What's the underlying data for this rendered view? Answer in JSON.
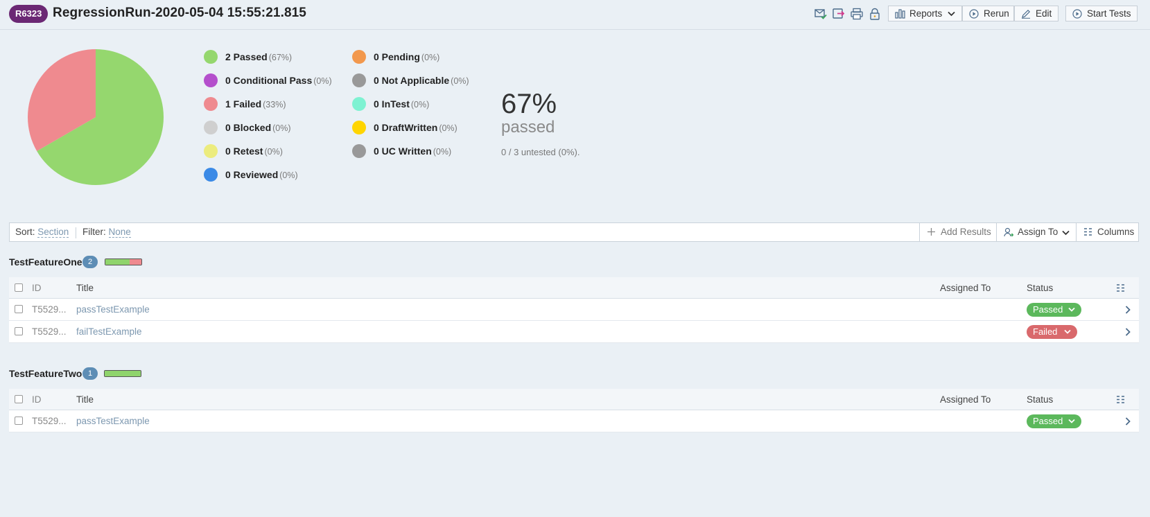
{
  "header": {
    "run_id": "R6323",
    "title": "RegressionRun-2020-05-04 15:55:21.815",
    "buttons": {
      "reports": "Reports",
      "rerun": "Rerun",
      "edit": "Edit",
      "start_tests": "Start Tests"
    }
  },
  "summary": {
    "chart_data": {
      "type": "pie",
      "categories": [
        "Passed",
        "Failed"
      ],
      "values": [
        2,
        1
      ],
      "colors": [
        "#95d76e",
        "#ef8a8f"
      ]
    },
    "legend": [
      {
        "label": "2 Passed",
        "pct": "(67%)",
        "color": "#95d76e"
      },
      {
        "label": "0 Conditional Pass",
        "pct": "(0%)",
        "color": "#b44fcc"
      },
      {
        "label": "1 Failed",
        "pct": "(33%)",
        "color": "#ef8a8f"
      },
      {
        "label": "0 Blocked",
        "pct": "(0%)",
        "color": "#cfcfcf"
      },
      {
        "label": "0 Retest",
        "pct": "(0%)",
        "color": "#ecec7e"
      },
      {
        "label": "0 Reviewed",
        "pct": "(0%)",
        "color": "#3b8ae6"
      },
      {
        "label": "0 Pending",
        "pct": "(0%)",
        "color": "#f2984d"
      },
      {
        "label": "0 Not Applicable",
        "pct": "(0%)",
        "color": "#999999"
      },
      {
        "label": "0 InTest",
        "pct": "(0%)",
        "color": "#7ef2d2"
      },
      {
        "label": "0 DraftWritten",
        "pct": "(0%)",
        "color": "#ffd500"
      },
      {
        "label": "0 UC Written",
        "pct": "(0%)",
        "color": "#999999"
      }
    ],
    "percent": "67%",
    "percent_label": "passed",
    "untested": "0 / 3 untested (0%)."
  },
  "toolbar": {
    "sort_label": "Sort:",
    "sort_value": "Section",
    "filter_label": "Filter:",
    "filter_value": "None",
    "add_results": "Add Results",
    "assign_to": "Assign To",
    "columns": "Columns"
  },
  "columns": {
    "id": "ID",
    "title": "Title",
    "assigned": "Assigned To",
    "status": "Status"
  },
  "sections": [
    {
      "name": "TestFeatureOne",
      "count": "2",
      "progress": {
        "passed": 0.67,
        "failed": 0.33
      },
      "rows": [
        {
          "id": "T5529...",
          "title": "passTestExample",
          "status": "Passed"
        },
        {
          "id": "T5529...",
          "title": "failTestExample",
          "status": "Failed"
        }
      ]
    },
    {
      "name": "TestFeatureTwo",
      "count": "1",
      "progress": {
        "passed": 1.0,
        "failed": 0
      },
      "rows": [
        {
          "id": "T5529...",
          "title": "passTestExample",
          "status": "Passed"
        }
      ]
    }
  ]
}
